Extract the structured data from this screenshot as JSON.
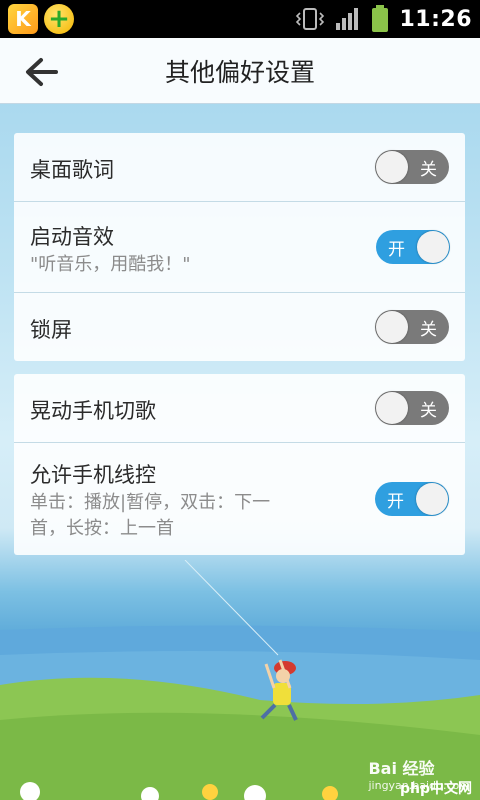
{
  "status_bar": {
    "app_icons": [
      "kuwo-app-icon",
      "plus-app-icon"
    ],
    "time": "11:26",
    "k_letter": "K",
    "plus_symbol": "+"
  },
  "header": {
    "title": "其他偏好设置",
    "back_icon": "back-arrow-icon"
  },
  "settings": {
    "group1": [
      {
        "title": "桌面歌词",
        "subtitle": "",
        "state": "off",
        "toggle_label": "关"
      },
      {
        "title": "启动音效",
        "subtitle": "\"听音乐，用酷我！\"",
        "state": "on",
        "toggle_label": "开"
      },
      {
        "title": "锁屏",
        "subtitle": "",
        "state": "off",
        "toggle_label": "关"
      }
    ],
    "group2": [
      {
        "title": "晃动手机切歌",
        "subtitle": "",
        "state": "off",
        "toggle_label": "关"
      },
      {
        "title": "允许手机线控",
        "subtitle_line1": "单击：播放|暂停，双击：下一",
        "subtitle_line2": "首，长按：上一首",
        "state": "on",
        "toggle_label": "开"
      }
    ]
  },
  "watermark": {
    "line1": "Bai 经验",
    "line2": "jingyan.baidu.com",
    "php": "php中文网"
  },
  "colors": {
    "toggle_on": "#2f9fe0",
    "toggle_off": "#7a7a7a",
    "sky": "#9ed3ec",
    "grass": "#9acd55"
  }
}
